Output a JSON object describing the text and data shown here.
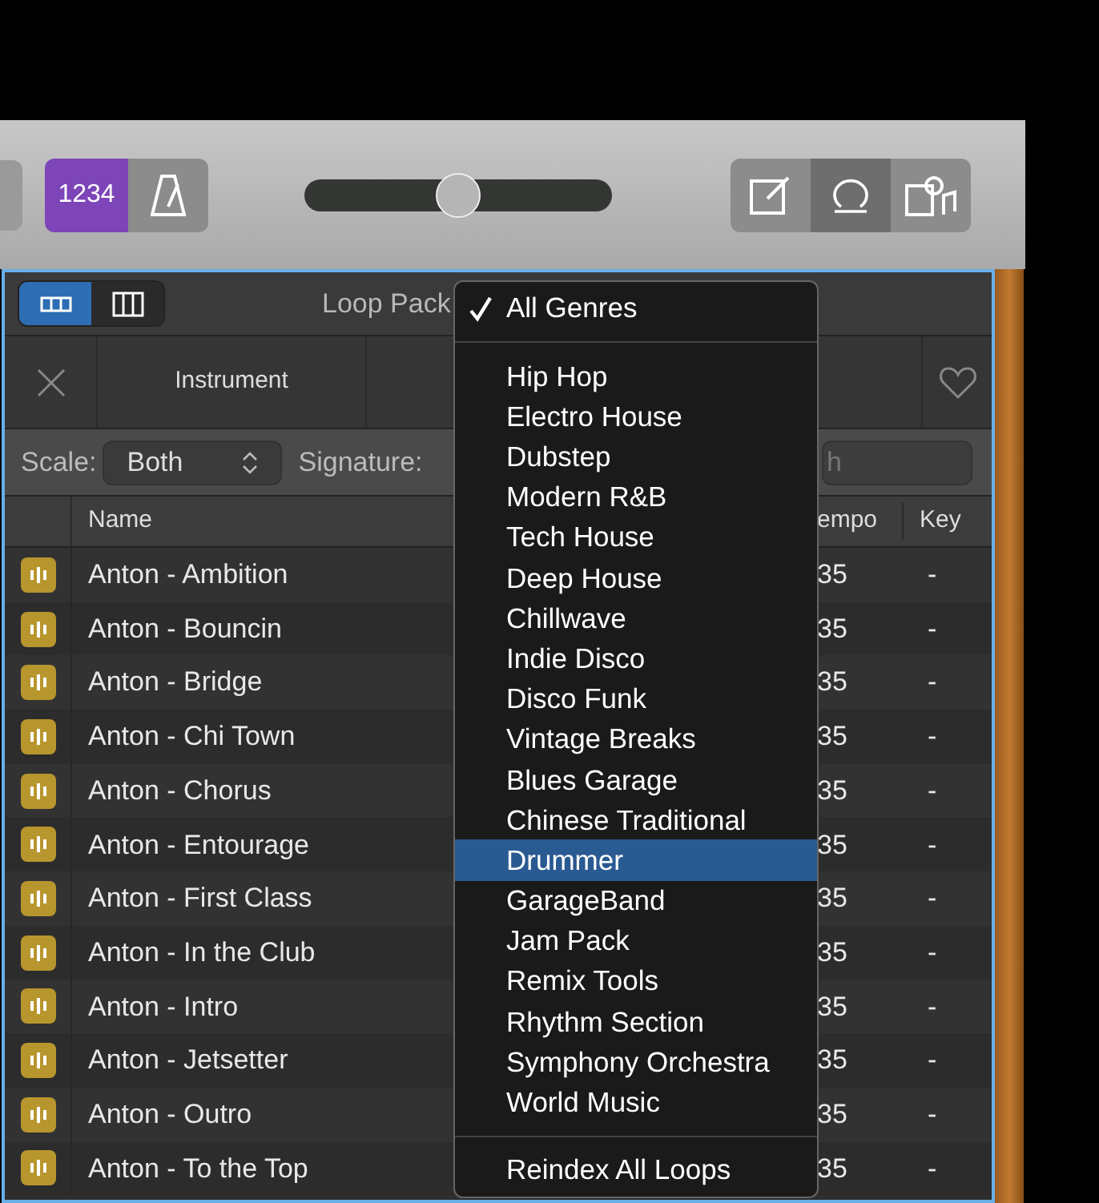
{
  "toolbar": {
    "count_in": {
      "label": "1234",
      "on": true
    },
    "metronome": {
      "on": false
    },
    "volume_slider": {
      "level": 0.5
    },
    "view_buttons": [
      {
        "kind": "note",
        "selected": false
      },
      {
        "kind": "loop",
        "selected": true
      },
      {
        "kind": "media",
        "selected": false
      }
    ]
  },
  "loop_browser": {
    "view_toggle": [
      {
        "kind": "list",
        "selected": true
      },
      {
        "kind": "columns",
        "selected": false
      }
    ],
    "title": "Loop Pack",
    "filter": "Instrument",
    "scale_label": "Scale:",
    "scale_value": "Both",
    "signature_label": "Signature:",
    "search": {
      "placeholder": "h"
    },
    "columns": [
      "Name",
      "empo",
      "Key"
    ],
    "rows": [
      {
        "name": "Anton - Ambition",
        "tempo": "35",
        "key": "-"
      },
      {
        "name": "Anton - Bouncin",
        "tempo": "35",
        "key": "-"
      },
      {
        "name": "Anton - Bridge",
        "tempo": "35",
        "key": "-"
      },
      {
        "name": "Anton - Chi Town",
        "tempo": "35",
        "key": "-"
      },
      {
        "name": "Anton - Chorus",
        "tempo": "35",
        "key": "-"
      },
      {
        "name": "Anton - Entourage",
        "tempo": "35",
        "key": "-"
      },
      {
        "name": "Anton - First Class",
        "tempo": "35",
        "key": "-"
      },
      {
        "name": "Anton - In the Club",
        "tempo": "35",
        "key": "-"
      },
      {
        "name": "Anton - Intro",
        "tempo": "35",
        "key": "-"
      },
      {
        "name": "Anton - Jetsetter",
        "tempo": "35",
        "key": "-"
      },
      {
        "name": "Anton - Outro",
        "tempo": "35",
        "key": "-"
      },
      {
        "name": "Anton - To the Top",
        "tempo": "35",
        "key": "-"
      }
    ]
  },
  "genre_menu": {
    "items": [
      {
        "kind": "item",
        "label": "All Genres",
        "checked": true,
        "selected": false
      },
      {
        "kind": "separator"
      },
      {
        "kind": "item",
        "label": "Hip Hop",
        "checked": false,
        "selected": false
      },
      {
        "kind": "item",
        "label": "Electro House",
        "checked": false,
        "selected": false
      },
      {
        "kind": "item",
        "label": "Dubstep",
        "checked": false,
        "selected": false
      },
      {
        "kind": "item",
        "label": "Modern R&B",
        "checked": false,
        "selected": false
      },
      {
        "kind": "item",
        "label": "Tech House",
        "checked": false,
        "selected": false
      },
      {
        "kind": "item",
        "label": "Deep House",
        "checked": false,
        "selected": false
      },
      {
        "kind": "item",
        "label": "Chillwave",
        "checked": false,
        "selected": false
      },
      {
        "kind": "item",
        "label": "Indie Disco",
        "checked": false,
        "selected": false
      },
      {
        "kind": "item",
        "label": "Disco Funk",
        "checked": false,
        "selected": false
      },
      {
        "kind": "item",
        "label": "Vintage Breaks",
        "checked": false,
        "selected": false
      },
      {
        "kind": "item",
        "label": "Blues Garage",
        "checked": false,
        "selected": false
      },
      {
        "kind": "item",
        "label": "Chinese Traditional",
        "checked": false,
        "selected": false
      },
      {
        "kind": "item",
        "label": "Drummer",
        "checked": false,
        "selected": true
      },
      {
        "kind": "item",
        "label": "GarageBand",
        "checked": false,
        "selected": false
      },
      {
        "kind": "item",
        "label": "Jam Pack",
        "checked": false,
        "selected": false
      },
      {
        "kind": "item",
        "label": "Remix Tools",
        "checked": false,
        "selected": false
      },
      {
        "kind": "item",
        "label": "Rhythm Section",
        "checked": false,
        "selected": false
      },
      {
        "kind": "item",
        "label": "Symphony Orchestra",
        "checked": false,
        "selected": false
      },
      {
        "kind": "item",
        "label": "World Music",
        "checked": false,
        "selected": false
      },
      {
        "kind": "separator"
      },
      {
        "kind": "item",
        "label": "Reindex All Loops",
        "checked": false,
        "selected": false
      }
    ]
  }
}
